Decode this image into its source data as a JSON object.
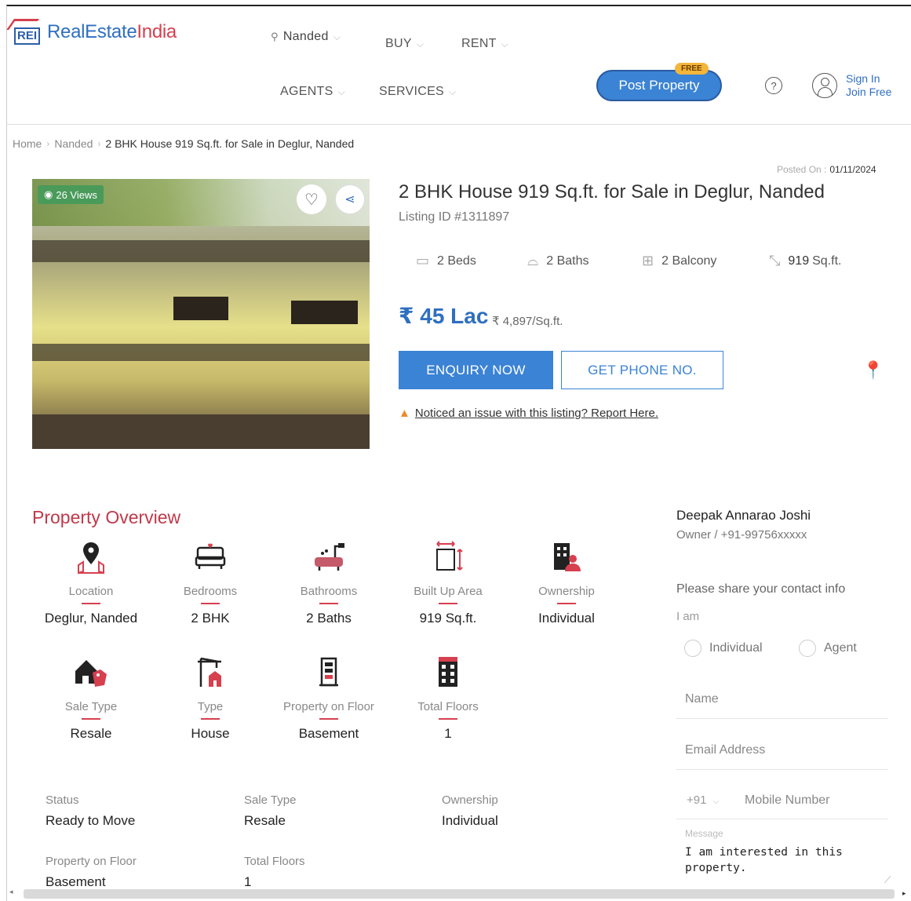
{
  "header": {
    "logo_badge": "REI",
    "logo_part1": "RealEstate",
    "logo_part2": "India",
    "city": "Nanded",
    "nav": {
      "buy": "BUY",
      "rent": "RENT",
      "agents": "AGENTS",
      "services": "SERVICES"
    },
    "post_property": "Post Property",
    "free_badge": "FREE",
    "help": "?",
    "sign_in": "Sign In",
    "join_free": "Join Free"
  },
  "breadcrumb": {
    "home": "Home",
    "city": "Nanded",
    "current": "2 BHK House 919 Sq.ft. for Sale in Deglur, Nanded"
  },
  "listing": {
    "views": "26 Views",
    "posted_label": "Posted On :",
    "posted_date": "01/11/2024",
    "title": "2 BHK House 919 Sq.ft. for Sale in Deglur, Nanded",
    "listing_id": "Listing ID #1311897",
    "specs": {
      "beds": "2 Beds",
      "baths": "2 Baths",
      "balcony": "2 Balcony",
      "area_value": "919",
      "area_unit": "Sq.ft."
    },
    "price": "₹ 45 Lac",
    "price_per_sqft": "₹ 4,897/Sq.ft.",
    "enquiry_button": "ENQUIRY NOW",
    "phone_button": "GET PHONE NO.",
    "report_text": "Noticed an issue with this listing? Report Here."
  },
  "overview": {
    "title": "Property Overview",
    "items": [
      {
        "label": "Location",
        "value": "Deglur, Nanded",
        "icon": "location-icon"
      },
      {
        "label": "Bedrooms",
        "value": "2 BHK",
        "icon": "bed-icon"
      },
      {
        "label": "Bathrooms",
        "value": "2 Baths",
        "icon": "bathtub-icon"
      },
      {
        "label": "Built Up Area",
        "value": "919 Sq.ft.",
        "icon": "area-icon"
      },
      {
        "label": "Ownership",
        "value": "Individual",
        "icon": "owner-icon"
      },
      {
        "label": "Sale Type",
        "value": "Resale",
        "icon": "sale-tag-icon"
      },
      {
        "label": "Type",
        "value": "House",
        "icon": "house-type-icon"
      },
      {
        "label": "Property on Floor",
        "value": "Basement",
        "icon": "floor-icon"
      },
      {
        "label": "Total Floors",
        "value": "1",
        "icon": "building-icon"
      }
    ],
    "grid": [
      {
        "label": "Status",
        "value": "Ready to Move"
      },
      {
        "label": "Sale Type",
        "value": "Resale"
      },
      {
        "label": "Ownership",
        "value": "Individual"
      },
      {
        "label": "Property on Floor",
        "value": "Basement"
      },
      {
        "label": "Total Floors",
        "value": "1"
      }
    ]
  },
  "contact": {
    "owner_name": "Deepak Annarao Joshi",
    "owner_info": "Owner / +91-99756xxxxx",
    "share_info": "Please share your contact info",
    "i_am": "I am",
    "option_individual": "Individual",
    "option_agent": "Agent",
    "name_placeholder": "Name",
    "email_placeholder": "Email Address",
    "country_code": "+91",
    "mobile_placeholder": "Mobile Number",
    "message_label": "Message",
    "message_text": "I am interested in this property."
  },
  "colors": {
    "brand_blue": "#3b83d4",
    "brand_red": "#d6404f"
  }
}
